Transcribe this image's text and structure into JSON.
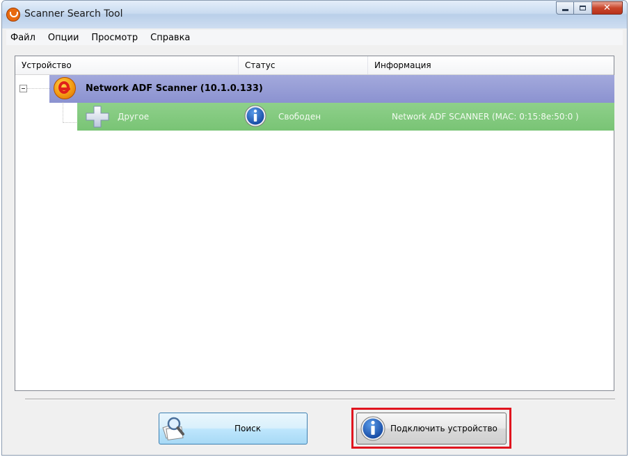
{
  "window": {
    "title": "Scanner Search Tool"
  },
  "menu": {
    "items": [
      "Файл",
      "Опции",
      "Просмотр",
      "Справка"
    ]
  },
  "list": {
    "columns": [
      "Устройство",
      "Статус",
      "Информация"
    ],
    "device": {
      "name": "Network ADF Scanner  (10.1.0.133)",
      "child": {
        "type": "Другое",
        "status": "Свободен",
        "info": "Network  ADF SCANNER  (MAC: 0:15:8e:50:0 )"
      }
    }
  },
  "buttons": {
    "search": "Поиск",
    "connect": "Подключить устройство"
  },
  "colors": {
    "device_row": "#8b92d0",
    "sub_row": "#79c475",
    "highlight": "#e0141e"
  },
  "icons": {
    "app": "scanner-logo-icon",
    "device": "scanner-logo-icon",
    "child": "plus-icon",
    "status": "info-icon",
    "search": "search-magnifier-icon",
    "connect": "info-icon"
  }
}
